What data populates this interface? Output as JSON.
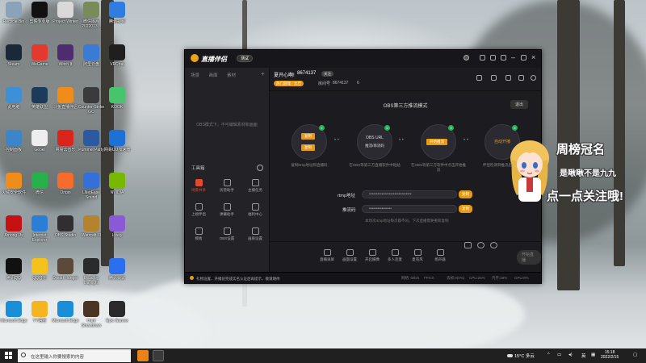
{
  "desktop": {
    "icons": [
      {
        "label": "Recycle Bin",
        "color": "#8aa3b8"
      },
      {
        "label": "Steam",
        "color": "#1b2838"
      },
      {
        "label": "此电脑",
        "color": "#3d8fd6"
      },
      {
        "label": "控制面板",
        "color": "#3a86c9"
      },
      {
        "label": "火绒安全软件",
        "color": "#f08c1a"
      },
      {
        "label": "Among Us",
        "color": "#c51111"
      },
      {
        "label": "腾讯QQ",
        "color": "#111111"
      },
      {
        "label": "Microsoft Edge",
        "color": "#1a8fd8"
      },
      {
        "label": "剪映专业版",
        "color": "#111111"
      },
      {
        "label": "WeGame",
        "color": "#e33a2d"
      },
      {
        "label": "英雄联盟",
        "color": "#1b3a5c"
      },
      {
        "label": "Geoel",
        "color": "#eeeeee"
      },
      {
        "label": "微信",
        "color": "#27b14a"
      },
      {
        "label": "Internet Explorer",
        "color": "#2a7ed6"
      },
      {
        "label": "QQ音乐",
        "color": "#f4c21b"
      },
      {
        "label": "YY语音",
        "color": "#f4b521"
      },
      {
        "label": "Project Winter",
        "color": "#d9d9d9"
      },
      {
        "label": "Witch It",
        "color": "#4e2d6f"
      },
      {
        "label": "斗鱼直播伴侣",
        "color": "#f08c1a"
      },
      {
        "label": "网易云音乐",
        "color": "#d9251c"
      },
      {
        "label": "Origin",
        "color": "#f56c2d"
      },
      {
        "label": "OBS Studio",
        "color": "#302e31"
      },
      {
        "label": "Dread Hunger",
        "color": "#5b4a3a"
      },
      {
        "label": "Microsoft Edge",
        "color": "#1a8fd8"
      },
      {
        "label": "微信图片 2022013...",
        "color": "#7a8b5a"
      },
      {
        "label": "阿里云盘",
        "color": "#3a7bd5"
      },
      {
        "label": "Counter-Strike GO",
        "color": "#3b3b3b"
      },
      {
        "label": "Pummel Party",
        "color": "#2c5aa0"
      },
      {
        "label": "LNetEase Sound",
        "color": "#3370d9"
      },
      {
        "label": "Warcraft III",
        "color": "#b5822d"
      },
      {
        "label": "Dead by Daylight",
        "color": "#2b2b2b"
      },
      {
        "label": "Hunt Showdown",
        "color": "#4a3525"
      },
      {
        "label": "腾讯视频",
        "color": "#2f7de1"
      },
      {
        "label": "VRChat",
        "color": "#1f1f1f"
      },
      {
        "label": "KOOK",
        "color": "#47c46c"
      },
      {
        "label": "网易UU加速器",
        "color": "#1d71d6"
      },
      {
        "label": "NVIDIA",
        "color": "#76b900"
      },
      {
        "label": "Lively",
        "color": "#8a5ad6"
      },
      {
        "label": "腾讯会议",
        "color": "#2b6ff0"
      },
      {
        "label": "Epic Games",
        "color": "#2a2a2a"
      }
    ]
  },
  "app": {
    "brand": "直播伴侣",
    "version": "测试",
    "left_tabs": [
      "场景",
      "画面",
      "素材"
    ],
    "empty_hint": "OBS模式下，不可编辑素材和画面",
    "tools_title": "工具箱",
    "tools": [
      {
        "label": "场景共享",
        "active": true
      },
      {
        "label": "房管助手",
        "active": false
      },
      {
        "label": "主播任务",
        "active": false
      },
      {
        "label": "上榜伴侣",
        "active": false
      },
      {
        "label": "弹幕助手",
        "active": false
      },
      {
        "label": "福利中心",
        "active": false
      },
      {
        "label": "模板",
        "active": false
      },
      {
        "label": "OBS设置",
        "active": false
      },
      {
        "label": "画质设置",
        "active": false
      }
    ],
    "room": {
      "name": "夏开心啊!",
      "id": "8674137",
      "follow_label": "关注",
      "tag": "热门游戏 · 大厅",
      "sub_label": "房间号",
      "sub_value": "8674137",
      "viewers": "6"
    },
    "mode_title": "OBS第三方推流模式",
    "exit_label": "退出",
    "steps": [
      {
        "num": "1",
        "buttons": [
          "复制",
          "复制"
        ],
        "desc": "复制rtmp地址和直播码"
      },
      {
        "num": "2",
        "lines": [
          "OBS URL",
          "推流/串流码"
        ],
        "desc": "在OBS等第三方直播软件中粘贴"
      },
      {
        "num": "3",
        "buttons": [
          "开始推流"
        ],
        "desc": "在OBS等第三方软件中点击开始推流"
      },
      {
        "num": "4",
        "lines": [
          "自动开播"
        ],
        "desc": "伴侣检测到推流后自动开播"
      }
    ],
    "rtmp_label": "rtmp地址",
    "rtmp_value": "••••••••••••••••••••••••••••••",
    "code_label": "推流码",
    "code_value": "••••••••••••••••",
    "copy_label": "复制",
    "note": "本场次rtmp地址每次都不同，下次直播需要重新复制",
    "bottom_items": [
      "直播录屏",
      "画面设置",
      "开启摄像",
      "多人连麦",
      "麦克风",
      "扬声器"
    ],
    "start_label": "开始直播",
    "status_warn": "礼物设置、开播前完成实名认证后再提示，敬请期待",
    "status_items": [
      "网络: 0kb/s",
      "FPS:0",
      "丢帧:0(0%)",
      "CPU:25%",
      "内存:28%",
      "GPU:0%"
    ]
  },
  "overlay": {
    "top": "周榜冠名",
    "middle": "是啾啾不是九九",
    "bottom": "点一点关注哦!"
  },
  "taskbar": {
    "search_placeholder": "在这里输入你要搜索的内容",
    "weather": "15°C 多云",
    "lang": "英",
    "time": "15:18",
    "date": "2022/2/15"
  }
}
